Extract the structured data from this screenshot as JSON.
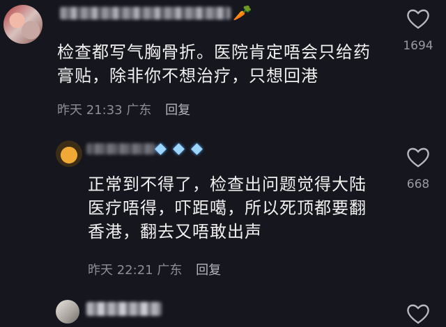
{
  "comments": [
    {
      "author": "",
      "text_lines": [
        "检查都写气胸骨折。医院肯定唔会只给药",
        "膏贴，除非你不想治疗，只想回港"
      ],
      "time": "昨天 21:33",
      "location": "广东",
      "reply_label": "回复",
      "like_count": "1694",
      "badge_icon": "carrot-icon"
    },
    {
      "author": "",
      "text_lines": [
        "正常到不得了，检查出问题觉得大陆",
        "医疗唔得，吓距噶，所以死顶都要翻",
        "香港，翻去又唔敢出声"
      ],
      "time": "昨天 22:21",
      "location": "广东",
      "reply_label": "回复",
      "like_count": "668",
      "badge_icon": "diamond-icon"
    },
    {
      "author": "",
      "like_count": ""
    }
  ],
  "colors": {
    "background": "#16161e",
    "text": "#f1f1f1",
    "meta": "#8e8e98",
    "carrot": "#ff8a2a",
    "diamond": "#9cd5ff"
  }
}
